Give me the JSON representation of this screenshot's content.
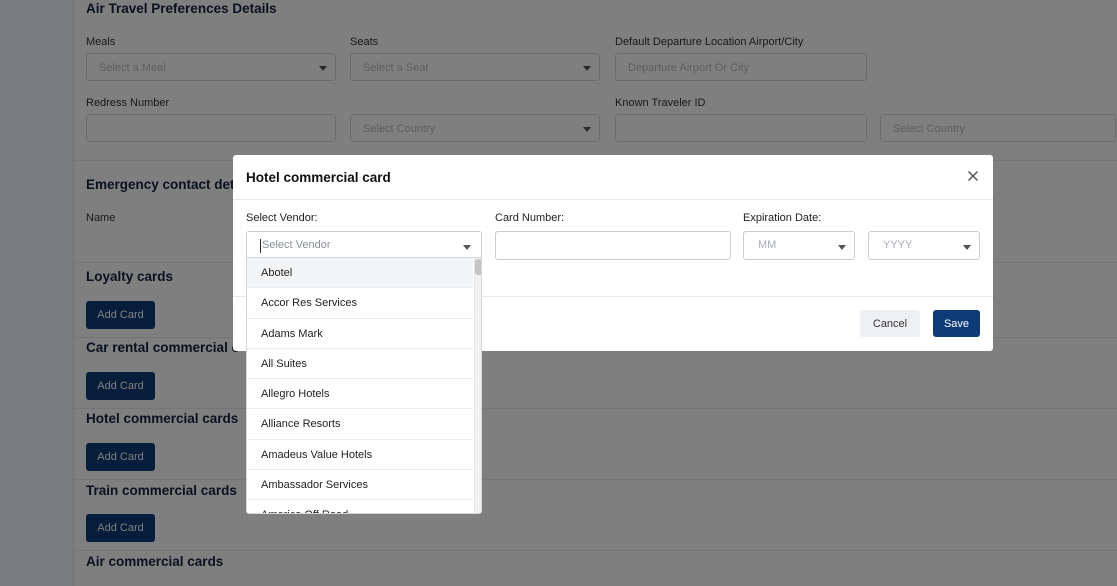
{
  "background": {
    "sections": {
      "air_travel": "Air Travel Preferences Details",
      "emergency": "Emergency contact det",
      "loyalty": "Loyalty cards",
      "car_rental": "Car rental commercial c",
      "hotel": "Hotel commercial cards",
      "train": "Train commercial cards",
      "air_commercial": "Air commercial cards"
    },
    "fields": {
      "meals_label": "Meals",
      "meals_placeholder": "Select a Meal",
      "seats_label": "Seats",
      "seats_placeholder": "Select a Seat",
      "departure_label": "Default Departure Location Airport/City",
      "departure_placeholder": "Departure Airport Or City",
      "redress_label": "Redress Number",
      "country_placeholder_1": "Select Country",
      "known_traveler_label": "Known Traveler ID",
      "country_placeholder_2": "Select Country",
      "name_label": "Name"
    },
    "add_card_label": "Add Card"
  },
  "modal": {
    "title": "Hotel commercial card",
    "vendor_label": "Select Vendor:",
    "vendor_placeholder": "Select Vendor",
    "card_number_label": "Card Number:",
    "card_number_value": "",
    "expiration_label": "Expiration Date:",
    "month_placeholder": "MM",
    "year_placeholder": "YYYY",
    "cancel_label": "Cancel",
    "save_label": "Save"
  },
  "vendors": [
    "Abotel",
    "Accor Res Services",
    "Adams Mark",
    "All Suites",
    "Allegro Hotels",
    "Alliance Resorts",
    "Amadeus Value Hotels",
    "Ambassador Services",
    "America Off Road"
  ],
  "colors": {
    "primary": "#0d3b78",
    "overlay": "rgba(0,0,0,0.5)",
    "title": "#14213d"
  },
  "icons": {
    "close": "close-icon",
    "dropdown": "chevron-down-icon"
  }
}
